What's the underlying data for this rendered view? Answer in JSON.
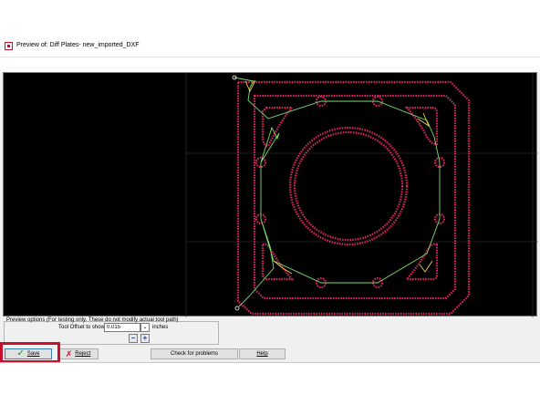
{
  "window": {
    "title": "Preview of: Diff Plates- new_imported_DXF"
  },
  "preview_options": {
    "title": "Preview options (For testing only. These do not modify actual tool path)",
    "offset_label": "Tool Offset to show:",
    "offset_value": "0.015",
    "unit_label": "inches",
    "minus_label": "−",
    "plus_label": "+"
  },
  "buttons": {
    "save_label": "Save",
    "reject_label": "Reject",
    "check_label": "Check for problems",
    "help_label": "Help"
  },
  "icons": {
    "window": "app-icon",
    "save": "checkmark-icon",
    "reject": "x-icon",
    "dropdown": "chevron-down-icon"
  },
  "colors": {
    "part_outline": "#d6255f",
    "tool_path": "#7fdc6f",
    "lead_in": "#e8d447",
    "grid": "#3a3a3a",
    "canvas_background": "#000000",
    "highlight": "#c8102e"
  }
}
